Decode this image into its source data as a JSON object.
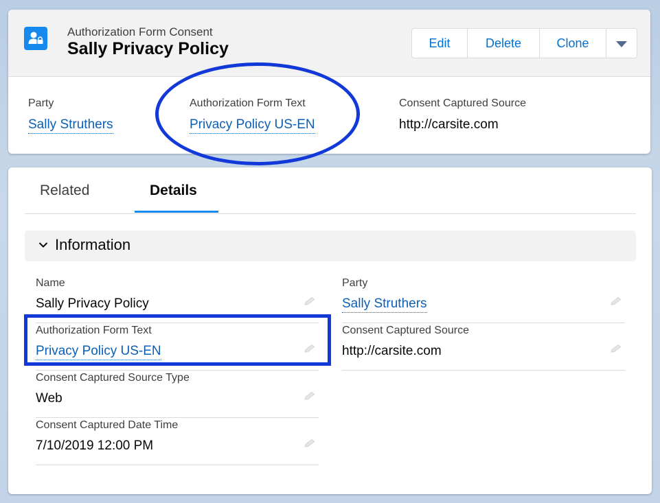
{
  "header": {
    "object_type": "Authorization Form Consent",
    "record_title": "Sally Privacy Policy",
    "actions": {
      "edit": "Edit",
      "delete": "Delete",
      "clone": "Clone"
    }
  },
  "highlights": [
    {
      "label": "Party",
      "value": "Sally Struthers"
    },
    {
      "label": "Authorization Form Text",
      "value": "Privacy Policy US-EN"
    },
    {
      "label": "Consent Captured Source",
      "value": "http://carsite.com"
    }
  ],
  "tabs": {
    "related": "Related",
    "details": "Details"
  },
  "section": {
    "title": "Information"
  },
  "fields": {
    "left": [
      {
        "label": "Name",
        "value": "Sally Privacy Policy"
      },
      {
        "label": "Authorization Form Text",
        "value": "Privacy Policy US-EN"
      },
      {
        "label": "Consent Captured Source Type",
        "value": "Web"
      },
      {
        "label": "Consent Captured Date Time",
        "value": "7/10/2019 12:00 PM"
      }
    ],
    "right": [
      {
        "label": "Party",
        "value": "Sally Struthers"
      },
      {
        "label": "Consent Captured Source",
        "value": "http://carsite.com"
      }
    ]
  },
  "colors": {
    "link": "#0b5fb5",
    "accent": "#1589ee",
    "annotation": "#1239d8"
  },
  "icons": {
    "object": "user-consent-icon",
    "more": "chevron-down-icon",
    "edit": "pencil-icon",
    "section": "chevron-down-icon"
  }
}
